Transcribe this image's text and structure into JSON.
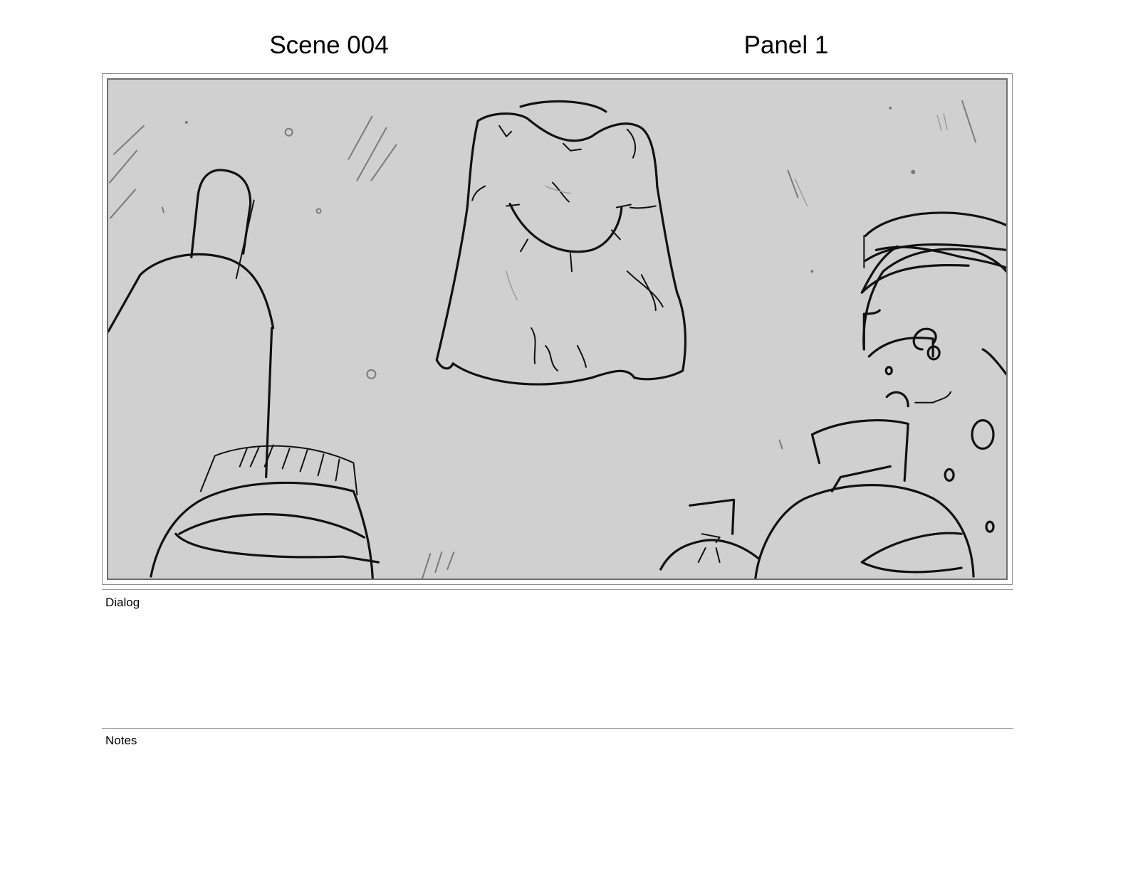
{
  "header": {
    "scene": "Scene 004",
    "panel": "Panel 1"
  },
  "panel_image": {
    "background_color": "#d0d0d0",
    "line_color": "#111111"
  },
  "dialog": {
    "label": "Dialog",
    "text": ""
  },
  "notes": {
    "label": "Notes",
    "text": ""
  }
}
